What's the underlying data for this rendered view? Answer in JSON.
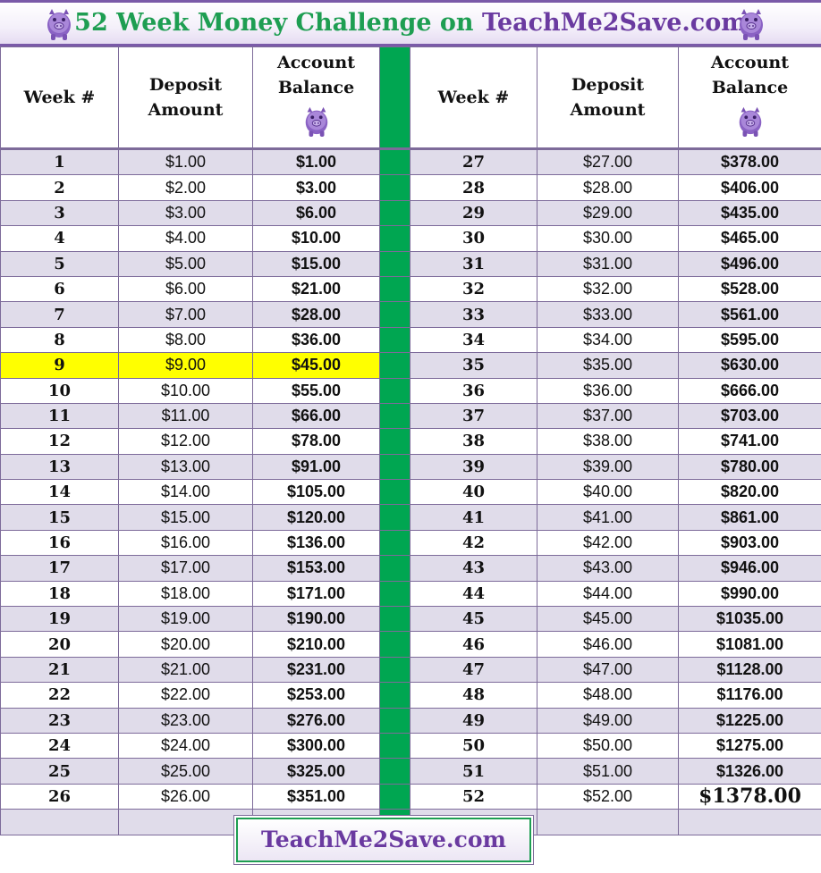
{
  "header": {
    "title_prefix": "52 Week Money Challenge on ",
    "title_brand": "TeachMe2Save.com",
    "week_label": "Week #",
    "deposit_line1": "Deposit",
    "deposit_line2": "Amount",
    "balance_line1": "Account",
    "balance_line2": "Balance"
  },
  "icons": {
    "pig": "piggy-bank-icon"
  },
  "colors": {
    "green_bar": "#00a651",
    "balance_text": "#137a1f",
    "highlight": "#ffff00",
    "purple": "#6a3aa0"
  },
  "highlight_week": 9,
  "left_rows": [
    {
      "week": "1",
      "deposit": "$1.00",
      "balance": "$1.00"
    },
    {
      "week": "2",
      "deposit": "$2.00",
      "balance": "$3.00"
    },
    {
      "week": "3",
      "deposit": "$3.00",
      "balance": "$6.00"
    },
    {
      "week": "4",
      "deposit": "$4.00",
      "balance": "$10.00"
    },
    {
      "week": "5",
      "deposit": "$5.00",
      "balance": "$15.00"
    },
    {
      "week": "6",
      "deposit": "$6.00",
      "balance": "$21.00"
    },
    {
      "week": "7",
      "deposit": "$7.00",
      "balance": "$28.00"
    },
    {
      "week": "8",
      "deposit": "$8.00",
      "balance": "$36.00"
    },
    {
      "week": "9",
      "deposit": "$9.00",
      "balance": "$45.00"
    },
    {
      "week": "10",
      "deposit": "$10.00",
      "balance": "$55.00"
    },
    {
      "week": "11",
      "deposit": "$11.00",
      "balance": "$66.00"
    },
    {
      "week": "12",
      "deposit": "$12.00",
      "balance": "$78.00"
    },
    {
      "week": "13",
      "deposit": "$13.00",
      "balance": "$91.00"
    },
    {
      "week": "14",
      "deposit": "$14.00",
      "balance": "$105.00"
    },
    {
      "week": "15",
      "deposit": "$15.00",
      "balance": "$120.00"
    },
    {
      "week": "16",
      "deposit": "$16.00",
      "balance": "$136.00"
    },
    {
      "week": "17",
      "deposit": "$17.00",
      "balance": "$153.00"
    },
    {
      "week": "18",
      "deposit": "$18.00",
      "balance": "$171.00"
    },
    {
      "week": "19",
      "deposit": "$19.00",
      "balance": "$190.00"
    },
    {
      "week": "20",
      "deposit": "$20.00",
      "balance": "$210.00"
    },
    {
      "week": "21",
      "deposit": "$21.00",
      "balance": "$231.00"
    },
    {
      "week": "22",
      "deposit": "$22.00",
      "balance": "$253.00"
    },
    {
      "week": "23",
      "deposit": "$23.00",
      "balance": "$276.00"
    },
    {
      "week": "24",
      "deposit": "$24.00",
      "balance": "$300.00"
    },
    {
      "week": "25",
      "deposit": "$25.00",
      "balance": "$325.00"
    },
    {
      "week": "26",
      "deposit": "$26.00",
      "balance": "$351.00"
    }
  ],
  "right_rows": [
    {
      "week": "27",
      "deposit": "$27.00",
      "balance": "$378.00"
    },
    {
      "week": "28",
      "deposit": "$28.00",
      "balance": "$406.00"
    },
    {
      "week": "29",
      "deposit": "$29.00",
      "balance": "$435.00"
    },
    {
      "week": "30",
      "deposit": "$30.00",
      "balance": "$465.00"
    },
    {
      "week": "31",
      "deposit": "$31.00",
      "balance": "$496.00"
    },
    {
      "week": "32",
      "deposit": "$32.00",
      "balance": "$528.00"
    },
    {
      "week": "33",
      "deposit": "$33.00",
      "balance": "$561.00"
    },
    {
      "week": "34",
      "deposit": "$34.00",
      "balance": "$595.00"
    },
    {
      "week": "35",
      "deposit": "$35.00",
      "balance": "$630.00"
    },
    {
      "week": "36",
      "deposit": "$36.00",
      "balance": "$666.00"
    },
    {
      "week": "37",
      "deposit": "$37.00",
      "balance": "$703.00"
    },
    {
      "week": "38",
      "deposit": "$38.00",
      "balance": "$741.00"
    },
    {
      "week": "39",
      "deposit": "$39.00",
      "balance": "$780.00"
    },
    {
      "week": "40",
      "deposit": "$40.00",
      "balance": "$820.00"
    },
    {
      "week": "41",
      "deposit": "$41.00",
      "balance": "$861.00"
    },
    {
      "week": "42",
      "deposit": "$42.00",
      "balance": "$903.00"
    },
    {
      "week": "43",
      "deposit": "$43.00",
      "balance": "$946.00"
    },
    {
      "week": "44",
      "deposit": "$44.00",
      "balance": "$990.00"
    },
    {
      "week": "45",
      "deposit": "$45.00",
      "balance": "$1035.00"
    },
    {
      "week": "46",
      "deposit": "$46.00",
      "balance": "$1081.00"
    },
    {
      "week": "47",
      "deposit": "$47.00",
      "balance": "$1128.00"
    },
    {
      "week": "48",
      "deposit": "$48.00",
      "balance": "$1176.00"
    },
    {
      "week": "49",
      "deposit": "$49.00",
      "balance": "$1225.00"
    },
    {
      "week": "50",
      "deposit": "$50.00",
      "balance": "$1275.00"
    },
    {
      "week": "51",
      "deposit": "$51.00",
      "balance": "$1326.00"
    },
    {
      "week": "52",
      "deposit": "$52.00",
      "balance": "$1378.00"
    }
  ],
  "footer": {
    "text": "TeachMe2Save.com"
  }
}
